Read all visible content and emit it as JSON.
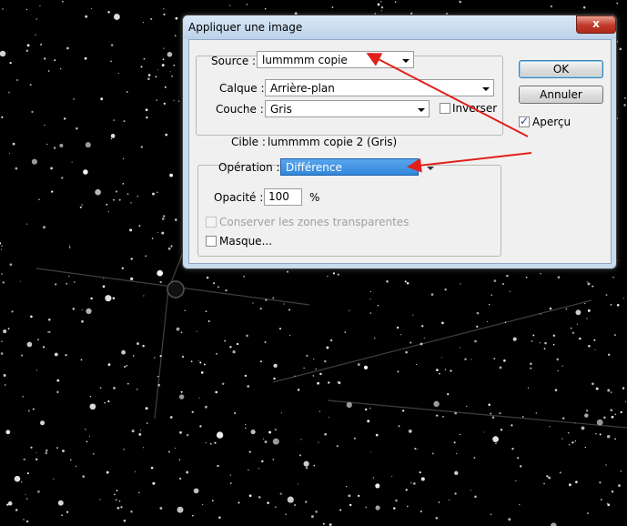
{
  "dialog": {
    "title": "Appliquer une image",
    "close_glyph": "x",
    "source": {
      "label": "Source :",
      "value": "lummmm copie"
    },
    "layer": {
      "label": "Calque :",
      "value": "Arrière-plan"
    },
    "channel": {
      "label": "Couche :",
      "value": "Gris"
    },
    "invert": {
      "label": "Inverser",
      "checked": false
    },
    "target": {
      "label": "Cible :",
      "value": "lummmm copie 2 (Gris)"
    },
    "blending": {
      "label": "Opération :",
      "value": "Différence"
    },
    "opacity": {
      "label": "Opacité :",
      "value": "100",
      "unit": "%"
    },
    "preserve_transparency": {
      "label": "Conserver les zones transparentes",
      "checked": false,
      "enabled": false
    },
    "mask": {
      "label": "Masque...",
      "checked": false
    },
    "ok_label": "OK",
    "cancel_label": "Annuler",
    "preview": {
      "label": "Aperçu",
      "checked": true
    }
  },
  "annotation": {
    "arrow_color": "#e0201b"
  }
}
